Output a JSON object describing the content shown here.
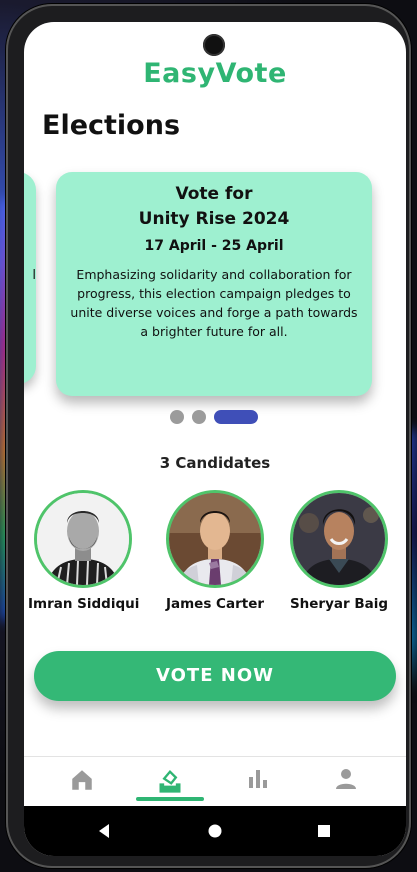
{
  "app": {
    "title": "EasyVote"
  },
  "page": {
    "title": "Elections"
  },
  "peek_card": {
    "text": "l"
  },
  "election_card": {
    "line1": "Vote for",
    "name": "Unity Rise 2024",
    "dates": "17 April  - 25 April",
    "description": "Emphasizing solidarity and collaboration for progress, this election campaign pledges to unite diverse voices and forge a path towards a brighter future for all.",
    "color": "#9ef0d0"
  },
  "carousel": {
    "pages": 3,
    "active_index": 2,
    "active_color": "#3f4fb8"
  },
  "candidates": {
    "title": "3 Candidates",
    "list": [
      {
        "name": "Imran Siddiqui",
        "avatar": "portrait-bw-beard-stripes"
      },
      {
        "name": "James Carter",
        "avatar": "portrait-shirt-tie"
      },
      {
        "name": "Sheryar Baig",
        "avatar": "portrait-smiling-jacket"
      }
    ]
  },
  "actions": {
    "vote_label": "VOTE NOW",
    "vote_color": "#34b876"
  },
  "bottom_nav": {
    "items": [
      {
        "name": "home",
        "icon": "home-icon"
      },
      {
        "name": "vote",
        "icon": "ballot-box-icon",
        "active": true
      },
      {
        "name": "results",
        "icon": "bar-chart-icon"
      },
      {
        "name": "profile",
        "icon": "person-icon"
      }
    ],
    "active_color": "#2fb573"
  },
  "system_nav": {
    "icons": [
      "back-icon",
      "home-circle-icon",
      "recents-icon"
    ]
  }
}
